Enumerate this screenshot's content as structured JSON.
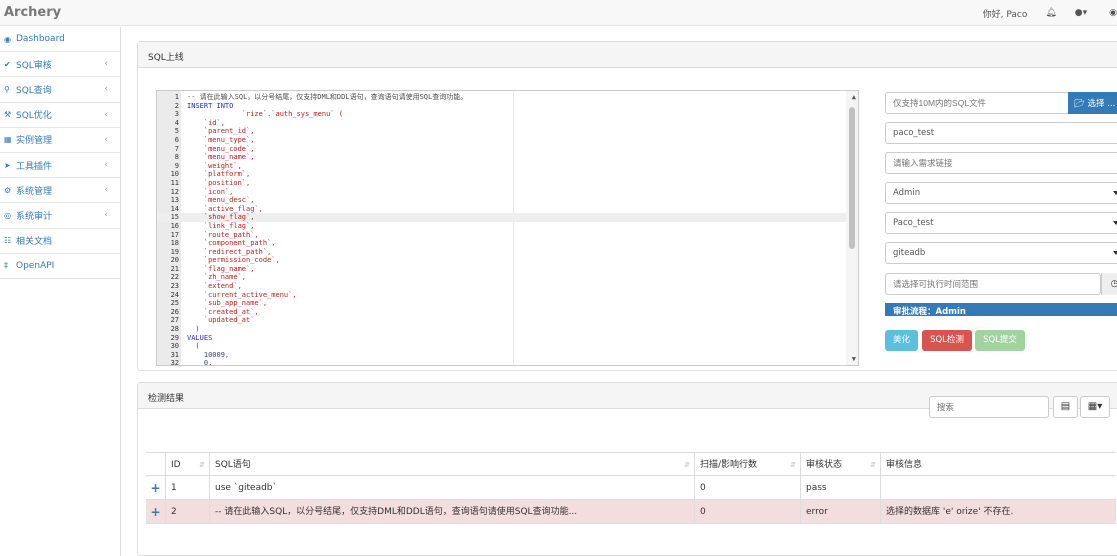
{
  "app": {
    "brand": "Archery"
  },
  "topbar": {
    "greeting": "你好, Paco",
    "bell_icon": "bell-icon",
    "user_icon": "user-icon",
    "github_icon": "github-icon"
  },
  "sidebar": {
    "items": [
      {
        "label": "Dashboard",
        "icon": "dashboard-icon",
        "has_submenu": false
      },
      {
        "label": "SQL审核",
        "icon": "check-icon",
        "has_submenu": true
      },
      {
        "label": "SQL查询",
        "icon": "search-icon",
        "has_submenu": true
      },
      {
        "label": "SQL优化",
        "icon": "wrench-icon",
        "has_submenu": true
      },
      {
        "label": "实例管理",
        "icon": "database-icon",
        "has_submenu": true
      },
      {
        "label": "工具插件",
        "icon": "rocket-icon",
        "has_submenu": true
      },
      {
        "label": "系统管理",
        "icon": "gears-icon",
        "has_submenu": true
      },
      {
        "label": "系统审计",
        "icon": "eye-icon",
        "has_submenu": true
      },
      {
        "label": "相关文档",
        "icon": "sitemap-icon",
        "has_submenu": false
      },
      {
        "label": "OpenAPI",
        "icon": "api-icon",
        "has_submenu": false
      }
    ]
  },
  "submit_panel": {
    "title": "SQL上线",
    "editor_lines": [
      {
        "n": "1",
        "code": "-- 请在此输入SQL，以分号结尾，仅支持DML和DDL语句，查询语句请使用SQL查询功能。",
        "style": "comment"
      },
      {
        "n": "2",
        "code": "INSERT INTO",
        "style": "kw"
      },
      {
        "n": "3",
        "code": "             `rize`.`auth_sys_menu` (",
        "style": "str"
      },
      {
        "n": "4",
        "code": "    `id`,",
        "style": "str"
      },
      {
        "n": "5",
        "code": "    `parent_id`,",
        "style": "str"
      },
      {
        "n": "6",
        "code": "    `menu_type`,",
        "style": "str"
      },
      {
        "n": "7",
        "code": "    `menu_code`,",
        "style": "str"
      },
      {
        "n": "8",
        "code": "    `menu_name`,",
        "style": "str"
      },
      {
        "n": "9",
        "code": "    `weight`,",
        "style": "str"
      },
      {
        "n": "10",
        "code": "    `platform`,",
        "style": "str"
      },
      {
        "n": "11",
        "code": "    `position`,",
        "style": "str"
      },
      {
        "n": "12",
        "code": "    `icon`,",
        "style": "str"
      },
      {
        "n": "13",
        "code": "    `menu_desc`,",
        "style": "str"
      },
      {
        "n": "14",
        "code": "    `active_flag`,",
        "style": "str"
      },
      {
        "n": "15",
        "code": "    `show_flag`,",
        "style": "str"
      },
      {
        "n": "16",
        "code": "    `link_flag`,",
        "style": "str"
      },
      {
        "n": "17",
        "code": "    `route_path`,",
        "style": "str"
      },
      {
        "n": "18",
        "code": "    `component_path`,",
        "style": "str"
      },
      {
        "n": "19",
        "code": "    `redirect_path`,",
        "style": "str"
      },
      {
        "n": "20",
        "code": "    `permission_code`,",
        "style": "str"
      },
      {
        "n": "21",
        "code": "    `flag_name`,",
        "style": "str"
      },
      {
        "n": "22",
        "code": "    `zh_name`,",
        "style": "str"
      },
      {
        "n": "23",
        "code": "    `extend`,",
        "style": "str"
      },
      {
        "n": "24",
        "code": "    `current_active_menu`,",
        "style": "str"
      },
      {
        "n": "25",
        "code": "    `sub_app_name`,",
        "style": "str"
      },
      {
        "n": "26",
        "code": "    `created_at`,",
        "style": "str"
      },
      {
        "n": "27",
        "code": "    `updated_at`",
        "style": "str"
      },
      {
        "n": "28",
        "code": "  )",
        "style": "plain"
      },
      {
        "n": "29",
        "code": "VALUES",
        "style": "kw"
      },
      {
        "n": "30",
        "code": "  (",
        "style": "plain"
      },
      {
        "n": "31",
        "code": "    10009,",
        "style": "plain"
      },
      {
        "n": "32",
        "code": "    0,",
        "style": "plain"
      }
    ],
    "highlighted_line": "15",
    "file_input": {
      "placeholder": "仅支持10M内的SQL文件",
      "button": "选择 ..."
    },
    "workflow_name": "paco_test",
    "demand_link_placeholder": "请输入需求链接",
    "group_select": "Admin",
    "instance_select": "Paco_test",
    "db_select": "giteadb",
    "time_range_placeholder": "请选择可执行时间范围",
    "flow_label": "审批流程：Admin",
    "buttons": {
      "beautify": "美化",
      "check": "SQL检测",
      "submit": "SQL提交"
    },
    "colors": {
      "beautify": "#5bc0de",
      "check": "#d9534f",
      "submit": "#9fd49f",
      "primary": "#337ab7"
    }
  },
  "result_panel": {
    "title": "检测结果",
    "search_placeholder": "搜索",
    "columns": [
      "ID",
      "SQL语句",
      "扫描/影响行数",
      "审核状态",
      "审核信息"
    ],
    "rows": [
      {
        "id": "1",
        "sql": "use `giteadb`",
        "rows": "0",
        "status": "pass",
        "info": ""
      },
      {
        "id": "2",
        "sql": "-- 请在此输入SQL，以分号结尾，仅支持DML和DDL语句，查询语句请使用SQL查询功能...",
        "rows": "0",
        "status": "error",
        "info": "选择的数据库 'e'              orize' 不存在."
      }
    ]
  }
}
